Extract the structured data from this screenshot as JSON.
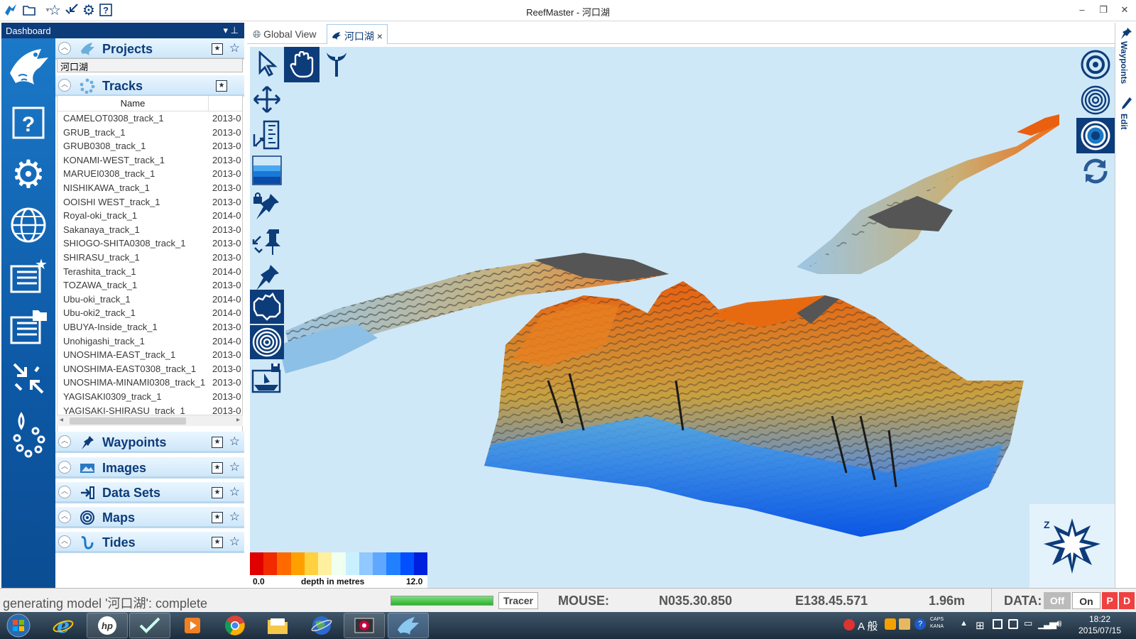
{
  "window": {
    "title": "ReefMaster - 河口湖"
  },
  "dashboard": {
    "title": "Dashboard",
    "pin_glyph": "▾ ⊥"
  },
  "projects": {
    "title": "Projects",
    "current": "河口湖"
  },
  "tracks": {
    "title": "Tracks",
    "column_name": "Name",
    "rows": [
      {
        "name": "CAMELOT0308_track_1",
        "date": "2013-0"
      },
      {
        "name": "GRUB_track_1",
        "date": "2013-0"
      },
      {
        "name": "GRUB0308_track_1",
        "date": "2013-0"
      },
      {
        "name": "KONAMI-WEST_track_1",
        "date": "2013-0"
      },
      {
        "name": "MARUEI0308_track_1",
        "date": "2013-0"
      },
      {
        "name": "NISHIKAWA_track_1",
        "date": "2013-0"
      },
      {
        "name": "OOISHI WEST_track_1",
        "date": "2013-0"
      },
      {
        "name": "Royal-oki_track_1",
        "date": "2014-0"
      },
      {
        "name": "Sakanaya_track_1",
        "date": "2013-0"
      },
      {
        "name": "SHIOGO-SHITA0308_track_1",
        "date": "2013-0"
      },
      {
        "name": "SHIRASU_track_1",
        "date": "2013-0"
      },
      {
        "name": "Terashita_track_1",
        "date": "2014-0"
      },
      {
        "name": "TOZAWA_track_1",
        "date": "2013-0"
      },
      {
        "name": "Ubu-oki_track_1",
        "date": "2014-0"
      },
      {
        "name": "Ubu-oki2_track_1",
        "date": "2014-0"
      },
      {
        "name": "UBUYA-Inside_track_1",
        "date": "2013-0"
      },
      {
        "name": "Unohigashi_track_1",
        "date": "2014-0"
      },
      {
        "name": "UNOSHIMA-EAST_track_1",
        "date": "2013-0"
      },
      {
        "name": "UNOSHIMA-EAST0308_track_1",
        "date": "2013-0"
      },
      {
        "name": "UNOSHIMA-MINAMI0308_track_1",
        "date": "2013-0"
      },
      {
        "name": "YAGISAKI0309_track_1",
        "date": "2013-0"
      },
      {
        "name": "YAGISAKI-SHIRASU_track_1",
        "date": "2013-0"
      }
    ]
  },
  "sections": {
    "waypoints": "Waypoints",
    "images": "Images",
    "datasets": "Data Sets",
    "maps": "Maps",
    "tides": "Tides"
  },
  "tabs": {
    "global": "Global View",
    "lake": "河口湖",
    "close": "×"
  },
  "right_strip": {
    "waypoints": "Waypoints",
    "edit": "Edit"
  },
  "legend": {
    "min": "0.0",
    "max": "12.0",
    "label": "depth in metres",
    "colors": [
      "#e00000",
      "#f22a00",
      "#ff6a00",
      "#ffa000",
      "#ffd040",
      "#fff0a0",
      "#f0fff0",
      "#c8f0ff",
      "#90c8ff",
      "#60a8ff",
      "#2080ff",
      "#0050ff",
      "#0020e0"
    ]
  },
  "status": {
    "message": "generating model '河口湖': complete",
    "progress": 1.0,
    "tracer": "Tracer",
    "mouse_label": "MOUSE:",
    "lat": "N035.30.850",
    "lon": "E138.45.571",
    "depth": "1.96m",
    "data_label": "DATA:",
    "off": "Off",
    "on": "On",
    "p": "P",
    "d": "D"
  },
  "taskbar": {
    "time": "18:22",
    "date": "2015/07/15",
    "caps": "CAPS",
    "kana": "KANA",
    "ime": "A 般"
  },
  "colors": {
    "accent": "#0d3c7a",
    "brand": "#1b79c8",
    "water": "#cfe8f8"
  }
}
